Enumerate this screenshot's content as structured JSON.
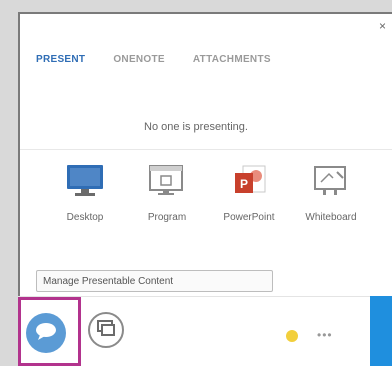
{
  "window": {
    "close_glyph": "×"
  },
  "tabs": [
    {
      "label": "PRESENT",
      "active": true
    },
    {
      "label": "ONENOTE",
      "active": false
    },
    {
      "label": "ATTACHMENTS",
      "active": false
    }
  ],
  "status_text": "No one is presenting.",
  "present_options": [
    {
      "label": "Desktop",
      "icon": "monitor-icon"
    },
    {
      "label": "Program",
      "icon": "program-window-icon"
    },
    {
      "label": "PowerPoint",
      "icon": "powerpoint-icon"
    },
    {
      "label": "Whiteboard",
      "icon": "whiteboard-icon"
    }
  ],
  "manage_button": "Manage Presentable Content",
  "bottom_bar": {
    "chat_icon": "chat-bubble-icon",
    "present_icon": "present-content-icon",
    "emoji_icon": "emoji-icon",
    "more_glyph": "•••"
  },
  "colors": {
    "accent": "#2f6db5",
    "highlight": "#b2338d",
    "chat_button": "#5b9bd5",
    "powerpoint": "#c8402c",
    "side_strip": "#1f8fde"
  }
}
